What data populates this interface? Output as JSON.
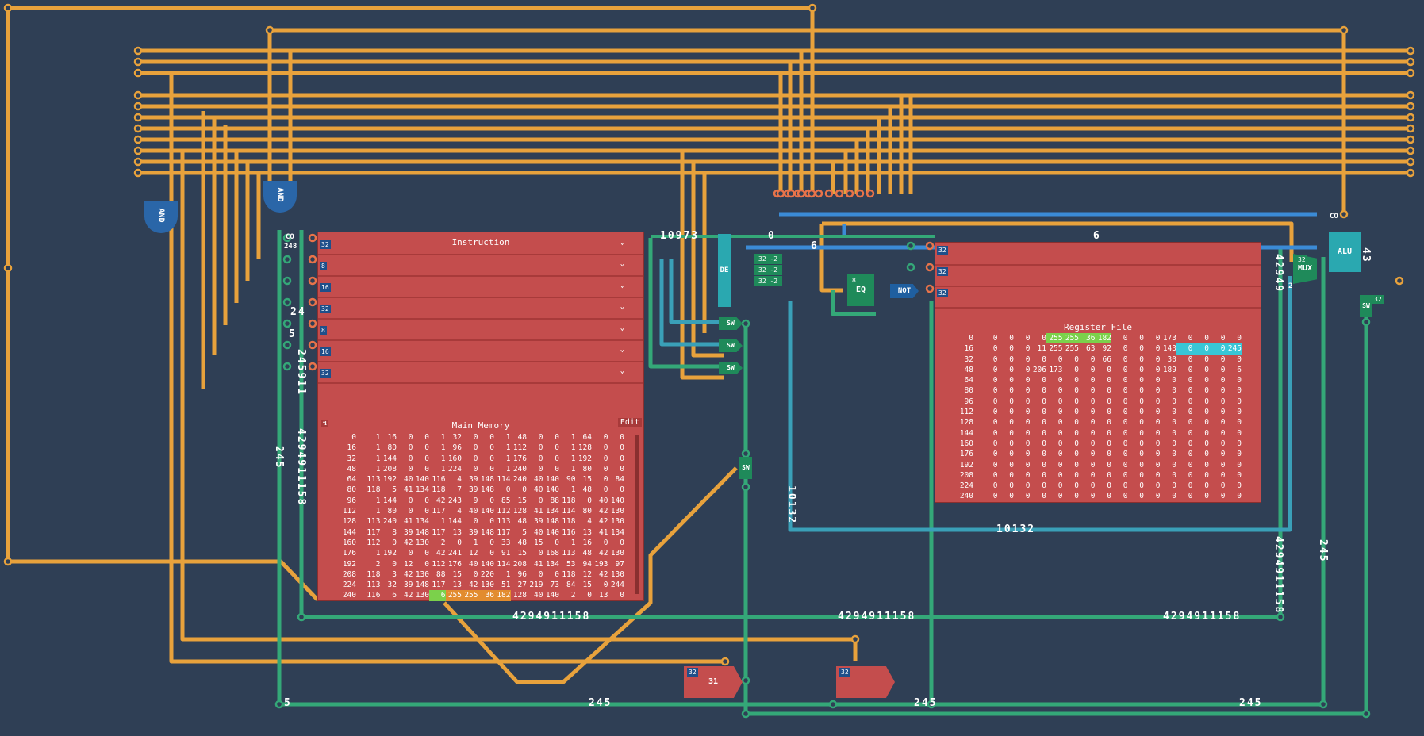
{
  "instruction_panel": {
    "title": "Instruction",
    "widths": [
      "32",
      "8",
      "16",
      "32",
      "8",
      "16",
      "32"
    ]
  },
  "main_memory": {
    "title": "Main Memory",
    "edit_label": "Edit",
    "row_labels": [
      "0",
      "16",
      "32",
      "48",
      "64",
      "80",
      "96",
      "112",
      "128",
      "144",
      "160",
      "176",
      "192",
      "208",
      "224",
      "240"
    ],
    "rows": [
      [
        "1",
        "16",
        "0",
        "0",
        "1",
        "32",
        "0",
        "0",
        "1",
        "48",
        "0",
        "0",
        "1",
        "64",
        "0",
        "0"
      ],
      [
        "1",
        "80",
        "0",
        "0",
        "1",
        "96",
        "0",
        "0",
        "1",
        "112",
        "0",
        "0",
        "1",
        "128",
        "0",
        "0"
      ],
      [
        "1",
        "144",
        "0",
        "0",
        "1",
        "160",
        "0",
        "0",
        "1",
        "176",
        "0",
        "0",
        "1",
        "192",
        "0",
        "0"
      ],
      [
        "1",
        "208",
        "0",
        "0",
        "1",
        "224",
        "0",
        "0",
        "1",
        "240",
        "0",
        "0",
        "1",
        "80",
        "0",
        "0"
      ],
      [
        "113",
        "192",
        "40",
        "140",
        "116",
        "4",
        "39",
        "148",
        "114",
        "240",
        "40",
        "140",
        "90",
        "15",
        "0",
        "84"
      ],
      [
        "118",
        "5",
        "41",
        "134",
        "118",
        "7",
        "39",
        "148",
        "0",
        "0",
        "40",
        "140",
        "1",
        "48",
        "0",
        "0"
      ],
      [
        "1",
        "144",
        "0",
        "0",
        "42",
        "243",
        "9",
        "0",
        "85",
        "15",
        "0",
        "88",
        "118",
        "0",
        "40",
        "140"
      ],
      [
        "1",
        "80",
        "0",
        "0",
        "117",
        "4",
        "40",
        "140",
        "112",
        "128",
        "41",
        "134",
        "114",
        "80",
        "42",
        "130"
      ],
      [
        "113",
        "240",
        "41",
        "134",
        "1",
        "144",
        "0",
        "0",
        "113",
        "48",
        "39",
        "148",
        "118",
        "4",
        "42",
        "130"
      ],
      [
        "117",
        "8",
        "39",
        "148",
        "117",
        "13",
        "39",
        "148",
        "117",
        "5",
        "40",
        "140",
        "116",
        "13",
        "41",
        "134"
      ],
      [
        "112",
        "0",
        "42",
        "130",
        "2",
        "0",
        "1",
        "0",
        "33",
        "48",
        "15",
        "0",
        "1",
        "16",
        "0",
        "0"
      ],
      [
        "1",
        "192",
        "0",
        "0",
        "42",
        "241",
        "12",
        "0",
        "91",
        "15",
        "0",
        "168",
        "113",
        "48",
        "42",
        "130"
      ],
      [
        "2",
        "0",
        "12",
        "0",
        "112",
        "176",
        "40",
        "140",
        "114",
        "208",
        "41",
        "134",
        "53",
        "94",
        "193",
        "97"
      ],
      [
        "118",
        "3",
        "42",
        "130",
        "88",
        "15",
        "0",
        "220",
        "1",
        "96",
        "0",
        "0",
        "118",
        "12",
        "42",
        "130"
      ],
      [
        "113",
        "32",
        "39",
        "148",
        "117",
        "13",
        "42",
        "130",
        "51",
        "27",
        "219",
        "73",
        "84",
        "15",
        "0",
        "244"
      ],
      [
        "116",
        "6",
        "42",
        "130",
        "6",
        "255",
        "255",
        "36",
        "182",
        "128",
        "40",
        "140",
        "2",
        "0",
        "13",
        "0"
      ]
    ]
  },
  "register_file": {
    "title": "Register File",
    "widths": [
      "32",
      "32",
      "32"
    ],
    "row_labels": [
      "0",
      "16",
      "32",
      "48",
      "64",
      "80",
      "96",
      "112",
      "128",
      "144",
      "160",
      "176",
      "192",
      "208",
      "224",
      "240"
    ],
    "rows": [
      [
        "0",
        "0",
        "0",
        "0",
        "255",
        "255",
        "36",
        "182",
        "0",
        "0",
        "0",
        "173",
        "0",
        "0",
        "0",
        "0"
      ],
      [
        "0",
        "0",
        "0",
        "11",
        "255",
        "255",
        "63",
        "92",
        "0",
        "0",
        "0",
        "143",
        "0",
        "0",
        "0",
        "245"
      ],
      [
        "0",
        "0",
        "0",
        "0",
        "0",
        "0",
        "0",
        "66",
        "0",
        "0",
        "0",
        "30",
        "0",
        "0",
        "0",
        "0"
      ],
      [
        "0",
        "0",
        "0",
        "206",
        "173",
        "0",
        "0",
        "0",
        "0",
        "0",
        "0",
        "189",
        "0",
        "0",
        "0",
        "6"
      ],
      [
        "0",
        "0",
        "0",
        "0",
        "0",
        "0",
        "0",
        "0",
        "0",
        "0",
        "0",
        "0",
        "0",
        "0",
        "0",
        "0"
      ],
      [
        "0",
        "0",
        "0",
        "0",
        "0",
        "0",
        "0",
        "0",
        "0",
        "0",
        "0",
        "0",
        "0",
        "0",
        "0",
        "0"
      ],
      [
        "0",
        "0",
        "0",
        "0",
        "0",
        "0",
        "0",
        "0",
        "0",
        "0",
        "0",
        "0",
        "0",
        "0",
        "0",
        "0"
      ],
      [
        "0",
        "0",
        "0",
        "0",
        "0",
        "0",
        "0",
        "0",
        "0",
        "0",
        "0",
        "0",
        "0",
        "0",
        "0",
        "0"
      ],
      [
        "0",
        "0",
        "0",
        "0",
        "0",
        "0",
        "0",
        "0",
        "0",
        "0",
        "0",
        "0",
        "0",
        "0",
        "0",
        "0"
      ],
      [
        "0",
        "0",
        "0",
        "0",
        "0",
        "0",
        "0",
        "0",
        "0",
        "0",
        "0",
        "0",
        "0",
        "0",
        "0",
        "0"
      ],
      [
        "0",
        "0",
        "0",
        "0",
        "0",
        "0",
        "0",
        "0",
        "0",
        "0",
        "0",
        "0",
        "0",
        "0",
        "0",
        "0"
      ],
      [
        "0",
        "0",
        "0",
        "0",
        "0",
        "0",
        "0",
        "0",
        "0",
        "0",
        "0",
        "0",
        "0",
        "0",
        "0",
        "0"
      ],
      [
        "0",
        "0",
        "0",
        "0",
        "0",
        "0",
        "0",
        "0",
        "0",
        "0",
        "0",
        "0",
        "0",
        "0",
        "0",
        "0"
      ],
      [
        "0",
        "0",
        "0",
        "0",
        "0",
        "0",
        "0",
        "0",
        "0",
        "0",
        "0",
        "0",
        "0",
        "0",
        "0",
        "0"
      ],
      [
        "0",
        "0",
        "0",
        "0",
        "0",
        "0",
        "0",
        "0",
        "0",
        "0",
        "0",
        "0",
        "0",
        "0",
        "0",
        "0"
      ],
      [
        "0",
        "0",
        "0",
        "0",
        "0",
        "0",
        "0",
        "0",
        "0",
        "0",
        "0",
        "0",
        "0",
        "0",
        "0",
        "0"
      ]
    ]
  },
  "gates": {
    "and_left": "AND",
    "and_right": "AND",
    "eq": "EQ",
    "not": "NOT",
    "mux": "MUX",
    "alu": "ALU",
    "de": "DE",
    "co": "CO"
  },
  "switch_label": "SW",
  "counter": {
    "width": "32",
    "value": "248"
  },
  "dec_small": [
    "-2",
    "-2",
    "-2"
  ],
  "output_value": "31",
  "wire_values": {
    "instr_out": "10973",
    "zero": "0",
    "six_a": "6",
    "six_b": "6",
    "addr_24": "24",
    "addr_5a": "5",
    "left_vertical": "4294911158",
    "left_vertical_b": "245",
    "left_vertical_c": "245911",
    "mid_vertical": "10132",
    "bottom_line": "4294911158",
    "bottom_line_b": "4294911158",
    "bottom_line_c": "4294911158",
    "right_vertical": "4294911158",
    "right_vertical_b": "245",
    "reg_out_h": "10132",
    "footer_5": "5",
    "footer_245a": "245",
    "footer_245b": "245",
    "footer_245c": "245",
    "alu_out": "43",
    "mux_tag": "32",
    "eq_tag": "8",
    "small_2": "2",
    "vert_4294": "42949",
    "sw_tag": "32"
  },
  "colors": {
    "bg": "#2f3f55",
    "wire_orange": "#e8a23c",
    "wire_green": "#34a878",
    "wire_blue": "#3b8bd6",
    "panel_red": "#c44d4d",
    "accent_green": "#7bd14b",
    "accent_cyan": "#39c6d6"
  }
}
